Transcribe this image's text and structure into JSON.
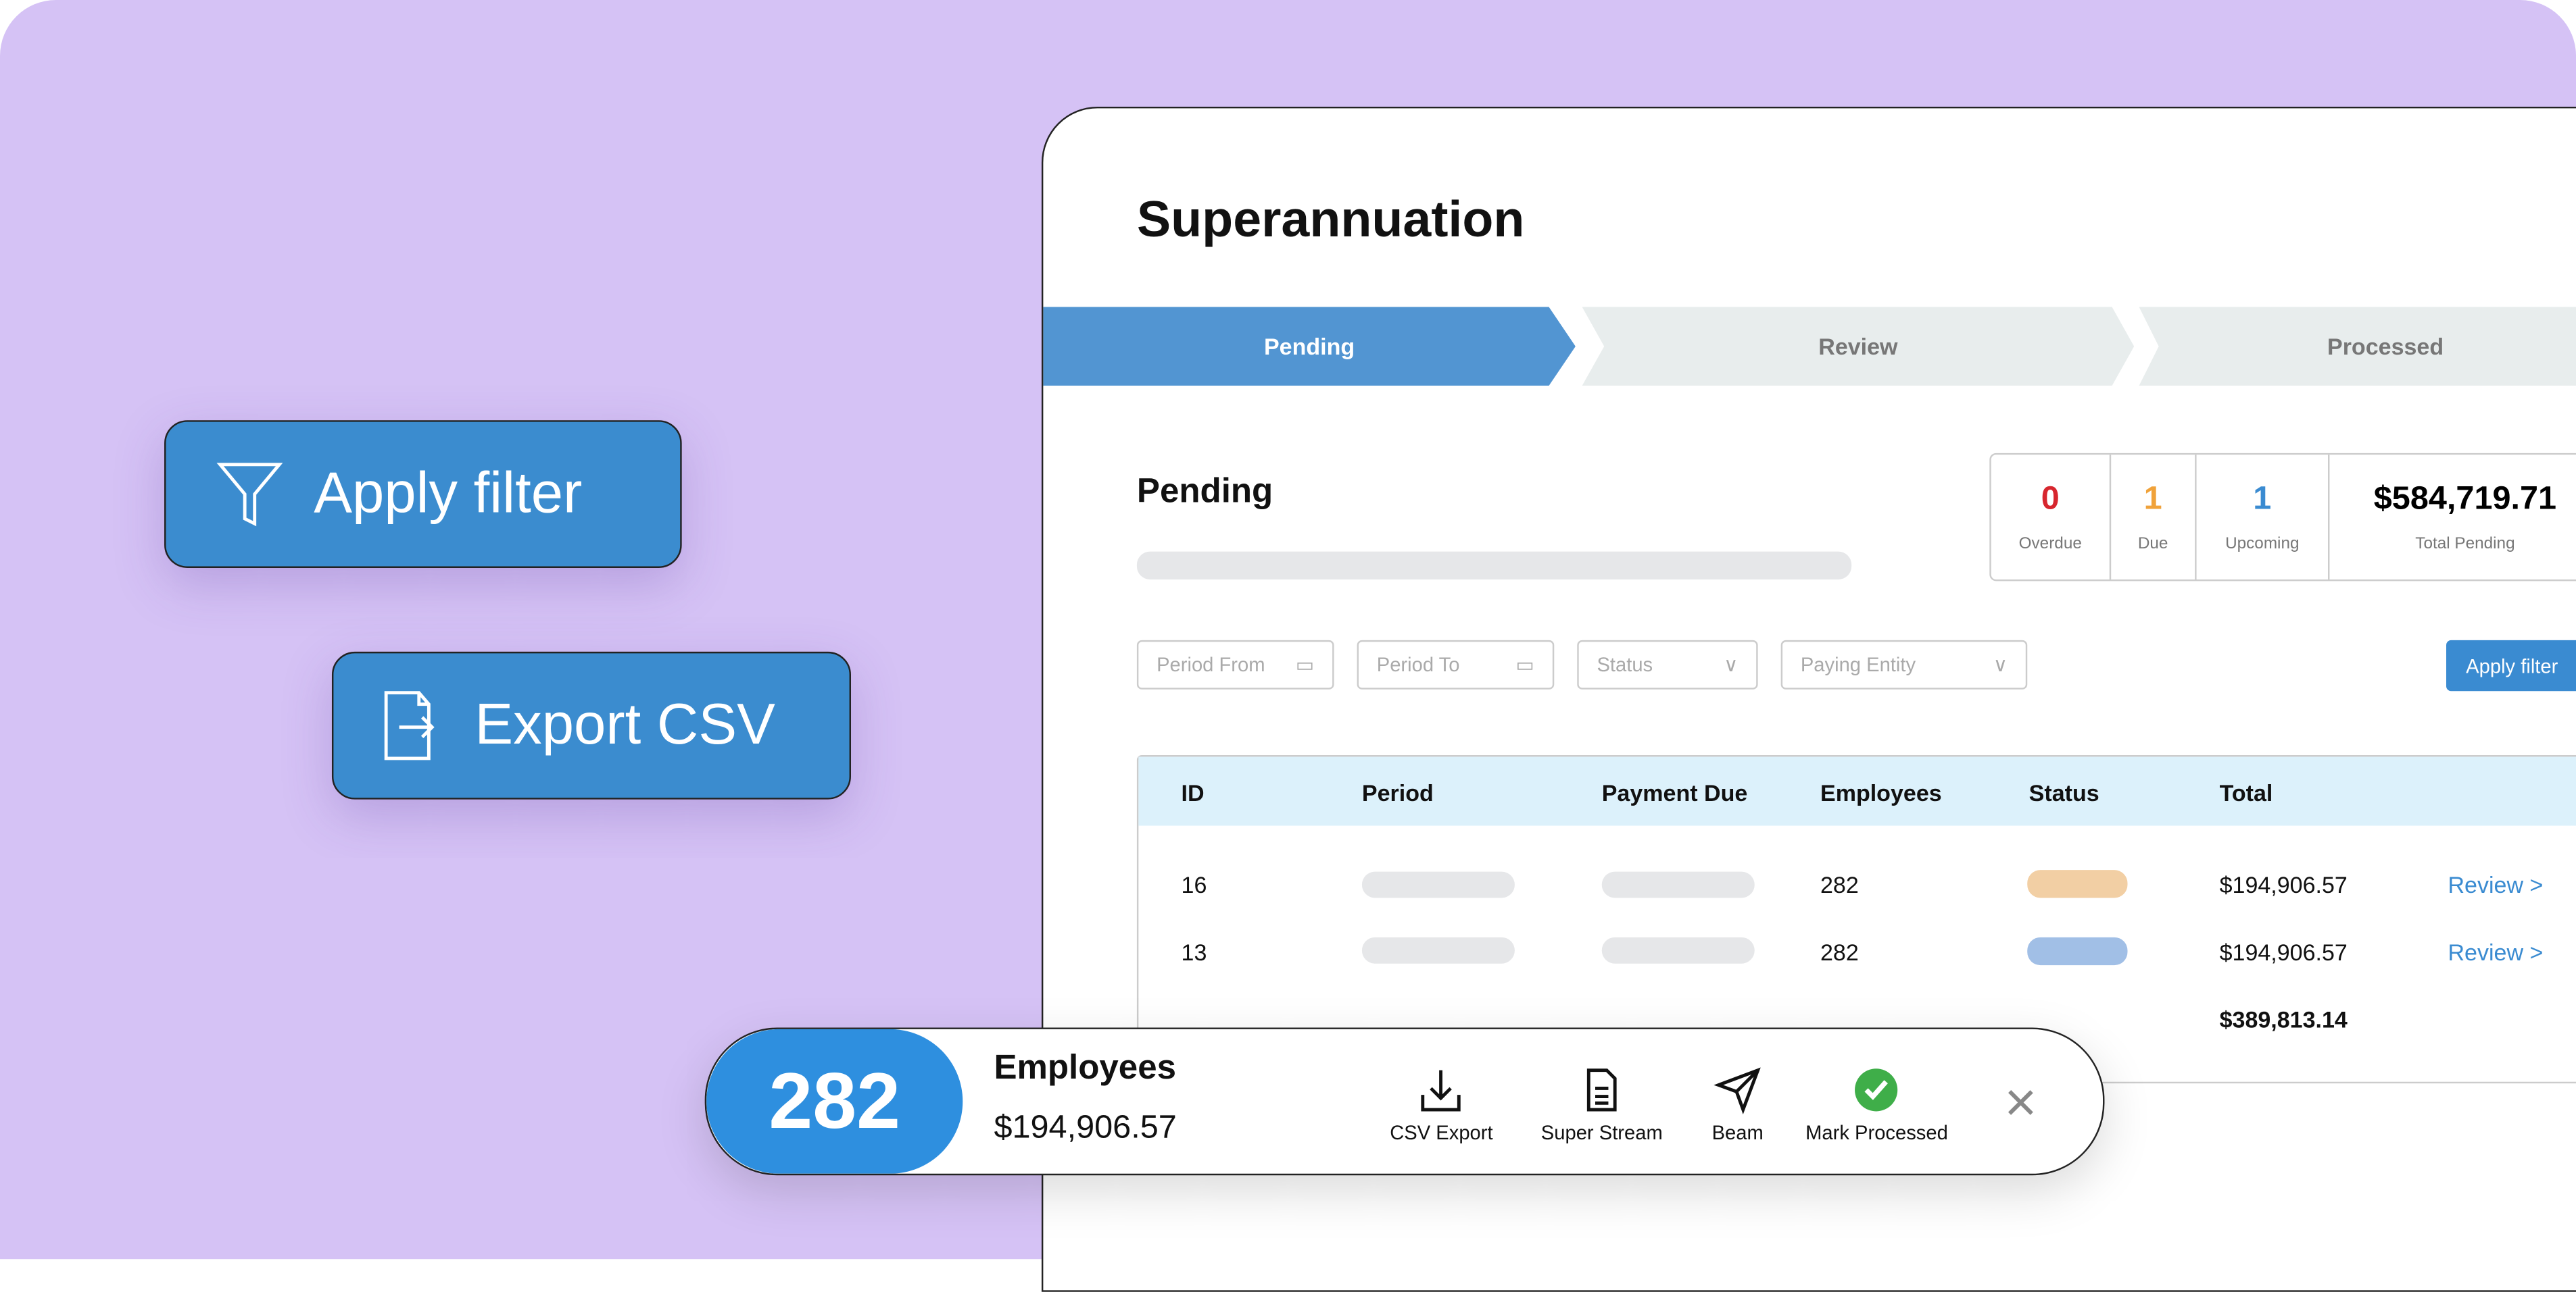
{
  "floating_buttons": {
    "apply_filter": "Apply filter",
    "export_csv": "Export CSV"
  },
  "page": {
    "title": "Superannuation"
  },
  "steps": [
    {
      "label": "Pending",
      "active": true
    },
    {
      "label": "Review",
      "active": false
    },
    {
      "label": "Processed",
      "active": false
    }
  ],
  "section": {
    "title": "Pending"
  },
  "stats": [
    {
      "value": "0",
      "label": "Overdue",
      "color": "#d7262e"
    },
    {
      "value": "1",
      "label": "Due",
      "color": "#f0a23a"
    },
    {
      "value": "1",
      "label": "Upcoming",
      "color": "#3a8bd1"
    },
    {
      "value": "$584,719.71",
      "label": "Total Pending",
      "color": "#111111"
    }
  ],
  "filters": {
    "period_from": "Period From",
    "period_to": "Period To",
    "status": "Status",
    "paying_entity": "Paying Entity",
    "apply": "Apply filter"
  },
  "table": {
    "headers": [
      "ID",
      "Period",
      "Payment Due",
      "Employees",
      "Status",
      "Total"
    ],
    "rows": [
      {
        "id": "16",
        "employees": "282",
        "status_color": "#f2cfa4",
        "total": "$194,906.57",
        "action": "Review >"
      },
      {
        "id": "13",
        "employees": "282",
        "status_color": "#a1bfe6",
        "total": "$194,906.57",
        "action": "Review >"
      }
    ],
    "grand_total": "$389,813.14"
  },
  "action_bar": {
    "count": "282",
    "label": "Employees",
    "amount": "$194,906.57",
    "actions": [
      {
        "label": "CSV Export",
        "icon": "download-icon"
      },
      {
        "label": "Super Stream",
        "icon": "document-icon"
      },
      {
        "label": "Beam",
        "icon": "paper-plane-icon"
      },
      {
        "label": "Mark Processed",
        "icon": "check-circle-icon"
      }
    ],
    "close": "×"
  }
}
